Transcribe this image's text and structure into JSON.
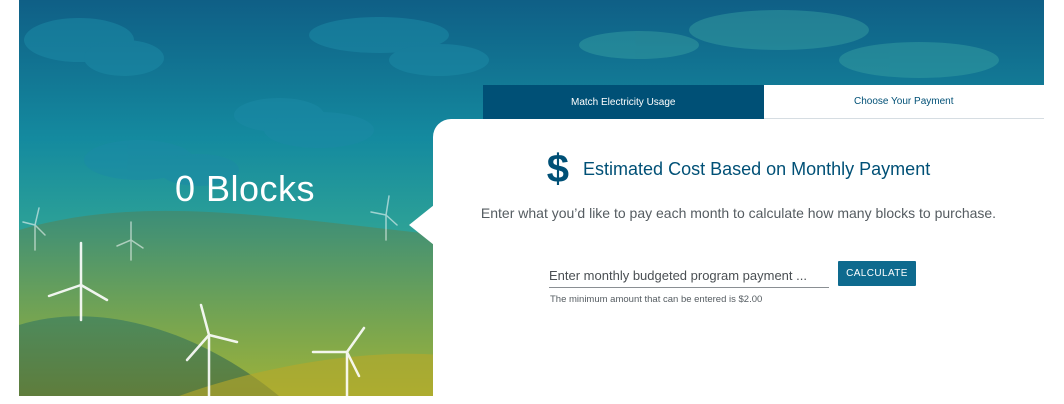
{
  "hero": {
    "blocks_label": "0 Blocks"
  },
  "tabs": [
    {
      "label": "Match Electricity Usage",
      "active": true
    },
    {
      "label": "Choose Your Payment",
      "active": false
    }
  ],
  "card": {
    "icon": "dollar-icon",
    "icon_glyph": "$",
    "title": "Estimated Cost Based on Monthly Payment",
    "description": "Enter what you’d like to pay each month to calculate how many blocks to purchase.",
    "input": {
      "value": "",
      "placeholder": "Enter monthly budgeted program payment ..."
    },
    "button_label": "CALCULATE",
    "hint": "The minimum amount that can be entered is $2.00"
  },
  "colors": {
    "brand": "#005076",
    "button": "#0e6a8e"
  }
}
